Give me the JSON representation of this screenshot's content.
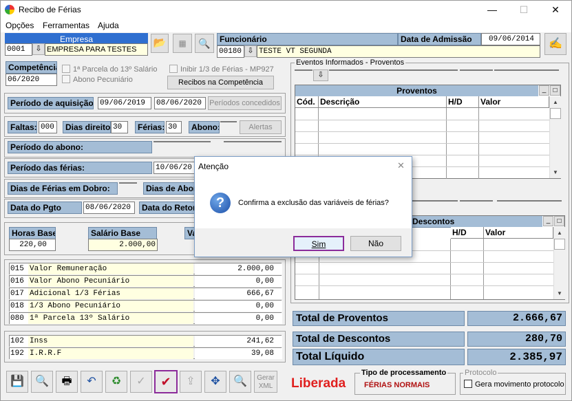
{
  "window": {
    "title": "Recibo de Férias",
    "minimize": "—",
    "maximize": "☐",
    "close": "✕"
  },
  "menu": {
    "items": [
      "Opções",
      "Ferramentas",
      "Ajuda"
    ]
  },
  "empresa": {
    "label": "Empresa",
    "code": "0001",
    "name": "EMPRESA PARA TESTES"
  },
  "funcionario": {
    "label": "Funcionário",
    "code": "00180",
    "name": "TESTE VT SEGUNDA",
    "admissao_label": "Data de Admissão",
    "admissao": "09/06/2014"
  },
  "competencia": {
    "label": "Competência",
    "value": "06/2020",
    "chk_parcela": "1ª Parcela do 13º Salário",
    "chk_abono": "Abono Pecuniário",
    "chk_inibir": "Inibir 1/3 de Férias - MP927",
    "recibos_btn": "Recibos na Competência"
  },
  "aquisicao": {
    "label": "Período de aquisição:",
    "inicio": "09/06/2019",
    "fim": "08/06/2020",
    "btn": "Períodos concedidos"
  },
  "faltas": {
    "label": "Faltas:",
    "value": "000",
    "dias_label": "Dias direito:",
    "dias": "30",
    "ferias_label": "Férias:",
    "ferias": "30",
    "abono_label": "Abono:",
    "abono": "",
    "alertas": "Alertas"
  },
  "periodo_abono": {
    "label": "Período do abono:"
  },
  "periodo_ferias": {
    "label": "Período das férias:",
    "inicio": "10/06/20"
  },
  "dias_dobro": {
    "label": "Dias de Férias em Dobro:",
    "abono_label": "Dias de Abon"
  },
  "pgto": {
    "label": "Data do Pgto",
    "value": "08/06/2020",
    "retorno_label": "Data do Retor"
  },
  "horas": {
    "label": "Horas Base",
    "value": "220,00",
    "salario_label": "Salário Base",
    "salario": "2.000,00",
    "va_label": "Va"
  },
  "proventos_rows": [
    {
      "code": "015",
      "desc": "Valor Remuneração",
      "value": "2.000,00"
    },
    {
      "code": "016",
      "desc": "Valor Abono Pecuniário",
      "value": "0,00"
    },
    {
      "code": "017",
      "desc": "Adicional 1/3 Férias",
      "value": "666,67"
    },
    {
      "code": "018",
      "desc": "1/3 Abono Pecuniário",
      "value": "0,00"
    },
    {
      "code": "080",
      "desc": "1ª Parcela 13º Salário",
      "value": "0,00"
    }
  ],
  "descontos_rows": [
    {
      "code": "102",
      "desc": "Inss",
      "value": "241,62"
    },
    {
      "code": "192",
      "desc": "I.R.R.F",
      "value": "39,08"
    }
  ],
  "eventos": {
    "title": "Eventos Informados - Proventos",
    "grid_title": "Proventos",
    "col_cod": "Cód.",
    "col_desc": "Descrição",
    "col_hd": "H/D",
    "col_valor": "Valor",
    "desc_title": "Descontos",
    "desc_col_hd": "H/D",
    "desc_col_valor": "Valor"
  },
  "totais": {
    "proventos_label": "Total de Proventos",
    "proventos": "2.666,67",
    "descontos_label": "Total de Descontos",
    "descontos": "280,70",
    "liquido_label": "Total Líquido",
    "liquido": "2.385,97"
  },
  "toolbar": {
    "gerar_xml": "Gerar XML"
  },
  "status": {
    "liberada": "Liberada",
    "tipo_label": "Tipo de processamento",
    "tipo": "FÉRIAS NORMAIS",
    "protocolo_label": "Protocolo",
    "protocolo_chk": "Gera movimento protocolo"
  },
  "dialog": {
    "title": "Atenção",
    "message": "Confirma a exclusão das variáveis de férias?",
    "sim": "Sim",
    "nao": "Não",
    "close": "✕"
  },
  "colors": {
    "label_bg": "#a4bdd6",
    "yellow_field": "#ffffe1",
    "liberada": "#e0201f",
    "tipo": "#b01010",
    "highlight": "#8b2b9a"
  }
}
